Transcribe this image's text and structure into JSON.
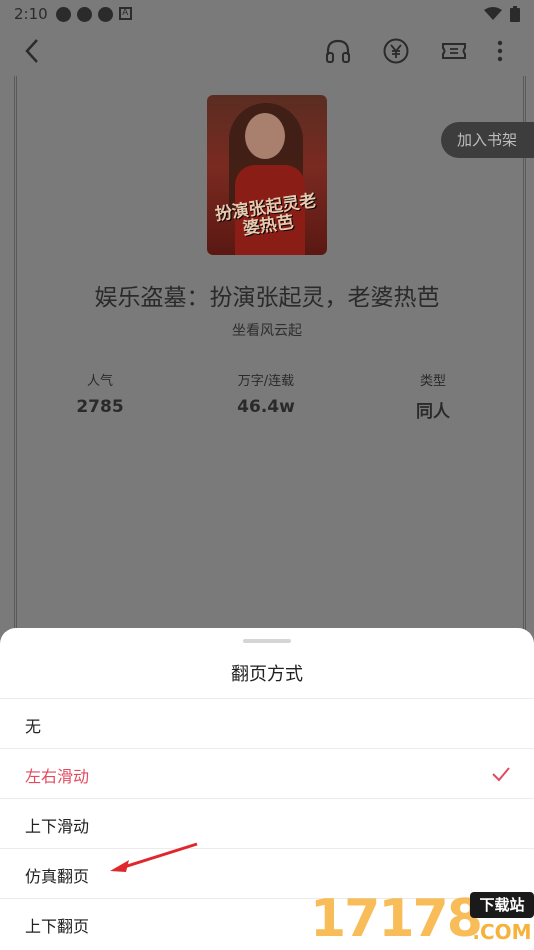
{
  "statusbar": {
    "time": "2:10",
    "icons": [
      "settings-icon",
      "settings-icon",
      "settings-icon",
      "a-icon"
    ],
    "right_icons": [
      "wifi-icon",
      "battery-icon"
    ]
  },
  "topbar": {
    "icons": [
      "back-icon",
      "headphones-icon",
      "yuan-icon",
      "ticket-icon",
      "more-icon"
    ]
  },
  "book": {
    "title": "娱乐盗墓：扮演张起灵，老婆热芭",
    "author": "坐看风云起",
    "cover_text": "扮演张起灵老婆热芭",
    "add_shelf": "加入书架",
    "stats": [
      {
        "label": "人气",
        "value": "2785"
      },
      {
        "label": "万字/连载",
        "value": "46.4w"
      },
      {
        "label": "类型",
        "value": "同人"
      }
    ]
  },
  "sheet": {
    "title": "翻页方式",
    "options": [
      {
        "label": "无",
        "selected": false
      },
      {
        "label": "左右滑动",
        "selected": true
      },
      {
        "label": "上下滑动",
        "selected": false
      },
      {
        "label": "仿真翻页",
        "selected": false
      },
      {
        "label": "上下翻页",
        "selected": false
      }
    ]
  },
  "watermark": {
    "number": "17178",
    "tag": "下载站",
    "suffix": ".COM"
  },
  "colors": {
    "accent": "#e24a5f",
    "overlay": "#7a7a7a",
    "watermark": "#f7b23b"
  }
}
